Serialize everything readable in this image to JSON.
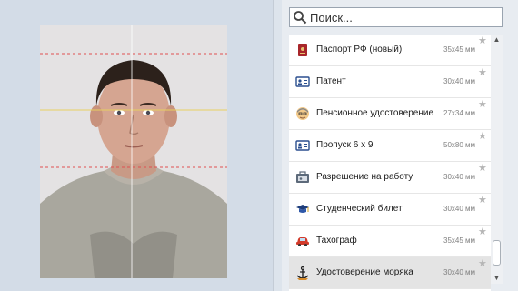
{
  "search": {
    "placeholder": "Поиск..."
  },
  "documents": [
    {
      "label": "Паспорт РФ (новый)",
      "size": "35х45 мм",
      "icon": "passport-icon"
    },
    {
      "label": "Патент",
      "size": "30х40 мм",
      "icon": "id-card-icon"
    },
    {
      "label": "Пенсионное удостоверение",
      "size": "27х34 мм",
      "icon": "elderly-person-icon"
    },
    {
      "label": "Пропуск 6 x 9",
      "size": "50х80 мм",
      "icon": "id-card-icon"
    },
    {
      "label": "Разрешение на работу",
      "size": "30х40 мм",
      "icon": "work-permit-icon"
    },
    {
      "label": "Студенческий билет",
      "size": "30х40 мм",
      "icon": "graduation-cap-icon"
    },
    {
      "label": "Тахограф",
      "size": "35х45 мм",
      "icon": "car-icon"
    },
    {
      "label": "Удостоверение моряка",
      "size": "30х40 мм",
      "icon": "anchor-icon"
    }
  ],
  "colors": {
    "guide_red": "#e05050",
    "guide_yellow": "#e8d060",
    "center_line": "#ffffff"
  }
}
